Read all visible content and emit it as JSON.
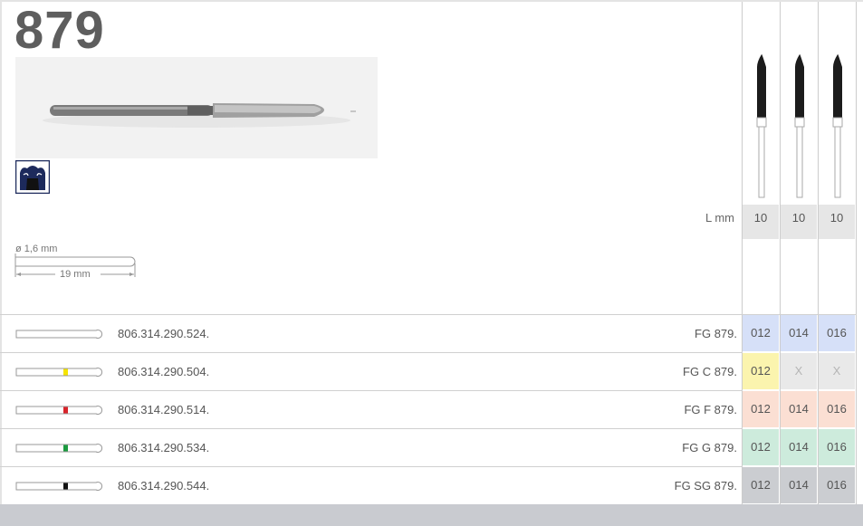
{
  "header": {
    "title": "879"
  },
  "dimensions": {
    "diameter": "ø 1,6 mm",
    "length": "19 mm"
  },
  "length_label": "L mm",
  "length_values": [
    "10",
    "10",
    "10"
  ],
  "rows": [
    {
      "article": "806.314.290.524.",
      "code": "FG 879.",
      "band": "none",
      "sizes": [
        "012",
        "014",
        "016"
      ],
      "cell_color": "#d6e0f8"
    },
    {
      "article": "806.314.290.504.",
      "code": "FG C 879.",
      "band": "#f5e400",
      "sizes": [
        "012",
        "X",
        "X"
      ],
      "cell_color": "#fbf4ae"
    },
    {
      "article": "806.314.290.514.",
      "code": "FG F 879.",
      "band": "#d8232a",
      "sizes": [
        "012",
        "014",
        "016"
      ],
      "cell_color": "#fbdfd3"
    },
    {
      "article": "806.314.290.534.",
      "code": "FG G 879.",
      "band": "#1a9a3e",
      "sizes": [
        "012",
        "014",
        "016"
      ],
      "cell_color": "#cdebdc"
    },
    {
      "article": "806.314.290.544.",
      "code": "FG SG 879.",
      "band": "#111111",
      "sizes": [
        "012",
        "014",
        "016"
      ],
      "cell_color": "#cbcdd1"
    }
  ],
  "disabled_color": "#e9e9e9",
  "icons": {
    "crown": "crown-preparation-icon"
  }
}
